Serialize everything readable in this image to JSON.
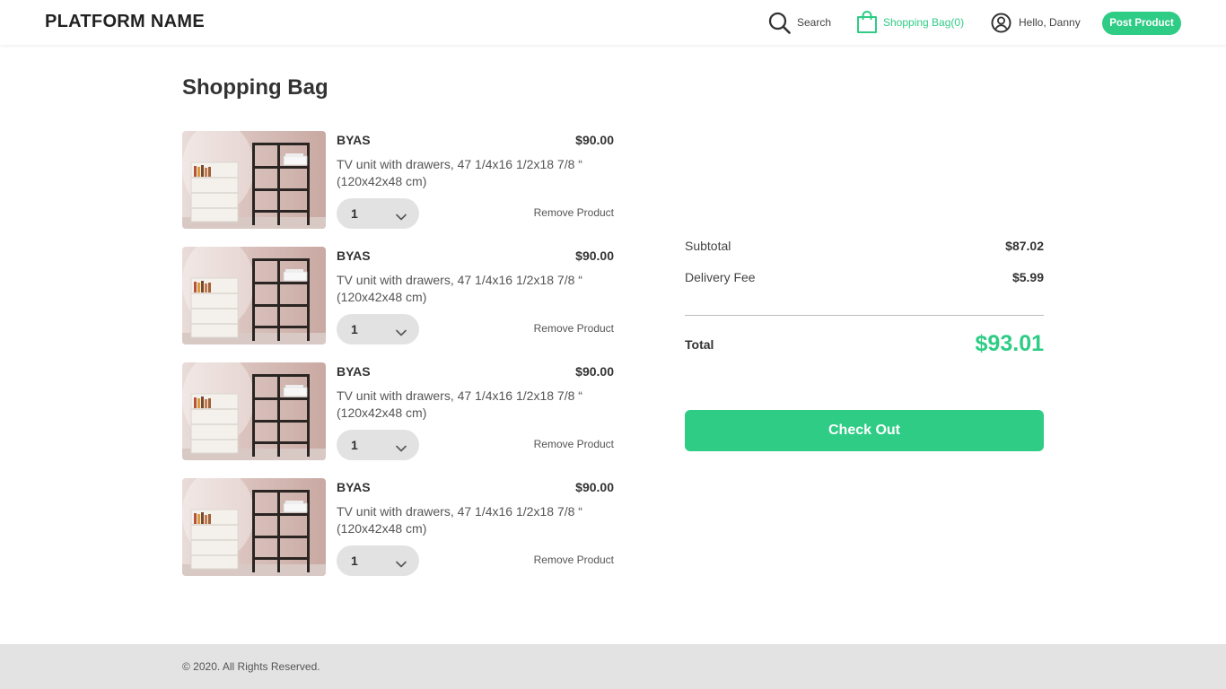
{
  "header": {
    "brand": "PLATFORM NAME",
    "search_label": "Search",
    "bag_label": "Shopping Bag(0)",
    "user_label": "Hello, Danny",
    "post_button": "Post Product"
  },
  "main": {
    "title": "Shopping Bag",
    "items": [
      {
        "brand": "BYAS",
        "price": "$90.00",
        "description": "TV unit with drawers, 47 1/4x16 1/2x18 7/8 “ (120x42x48 cm)",
        "quantity": "1",
        "remove_label": "Remove Product",
        "image": "shelf-product-image"
      },
      {
        "brand": "BYAS",
        "price": "$90.00",
        "description": "TV unit with drawers, 47 1/4x16 1/2x18 7/8 “ (120x42x48 cm)",
        "quantity": "1",
        "remove_label": "Remove Product",
        "image": "shelf-product-image"
      },
      {
        "brand": "BYAS",
        "price": "$90.00",
        "description": "TV unit with drawers, 47 1/4x16 1/2x18 7/8 “ (120x42x48 cm)",
        "quantity": "1",
        "remove_label": "Remove Product",
        "image": "shelf-product-image"
      },
      {
        "brand": "BYAS",
        "price": "$90.00",
        "description": "TV unit with drawers, 47 1/4x16 1/2x18 7/8 “ (120x42x48 cm)",
        "quantity": "1",
        "remove_label": "Remove Product",
        "image": "shelf-product-image"
      }
    ]
  },
  "summary": {
    "subtotal_label": "Subtotal",
    "subtotal_value": "$87.02",
    "delivery_label": "Delivery Fee",
    "delivery_value": "$5.99",
    "total_label": "Total",
    "total_value": "$93.01",
    "checkout_label": "Check Out"
  },
  "footer": {
    "copyright": "© 2020. All Rights Reserved."
  },
  "colors": {
    "accent": "#2ecc85",
    "footer_bg": "#e3e3e3",
    "qty_bg": "#e2e2e2"
  },
  "icons": {
    "search": "search-icon",
    "bag": "shopping-bag-icon",
    "user": "user-circle-icon",
    "chevron": "chevron-down-icon"
  }
}
